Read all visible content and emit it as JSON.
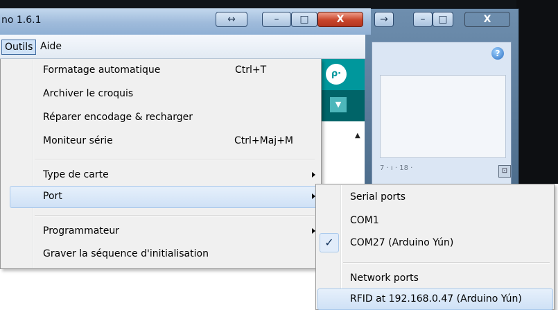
{
  "window": {
    "title": "no 1.6.1",
    "controls": {
      "resize": "↔",
      "minimize": "–",
      "maximize": "□",
      "close": "X"
    }
  },
  "background_window": {
    "controls": {
      "back": "→",
      "minimize": "–",
      "maximize": "□",
      "close": "X"
    },
    "help_icon": "?",
    "ruler": "7 · ı · 18 ·"
  },
  "menubar": {
    "items": [
      "Outils",
      "Aide"
    ]
  },
  "tools_menu": {
    "items": [
      {
        "label": "Formatage automatique",
        "shortcut": "Ctrl+T"
      },
      {
        "label": "Archiver le croquis",
        "shortcut": ""
      },
      {
        "label": "Réparer encodage & recharger",
        "shortcut": ""
      },
      {
        "label": "Moniteur série",
        "shortcut": "Ctrl+Maj+M"
      },
      {
        "label": "Type de carte",
        "shortcut": "",
        "submenu": true
      },
      {
        "label": "Port",
        "shortcut": "",
        "submenu": true,
        "highlighted": true
      },
      {
        "label": "Programmateur",
        "shortcut": "",
        "submenu": true
      },
      {
        "label": "Graver la séquence d'initialisation",
        "shortcut": ""
      }
    ]
  },
  "port_submenu": {
    "items": [
      {
        "label": "Serial ports",
        "checked": false
      },
      {
        "label": "COM1",
        "checked": false
      },
      {
        "label": "COM27 (Arduino Yún)",
        "checked": true
      },
      {
        "label": "Network ports",
        "checked": false
      },
      {
        "label": "RFID at 192.168.0.47 (Arduino Yún)",
        "checked": false,
        "highlighted": true
      }
    ]
  },
  "ide": {
    "serial_monitor_icon": "magnifier-icon",
    "tab_menu_icon": "chevron-down-icon"
  },
  "colors": {
    "arduino_teal": "#00979c",
    "menu_highlight": "#cfe1f6",
    "menu_bg": "#f0f0f0"
  }
}
